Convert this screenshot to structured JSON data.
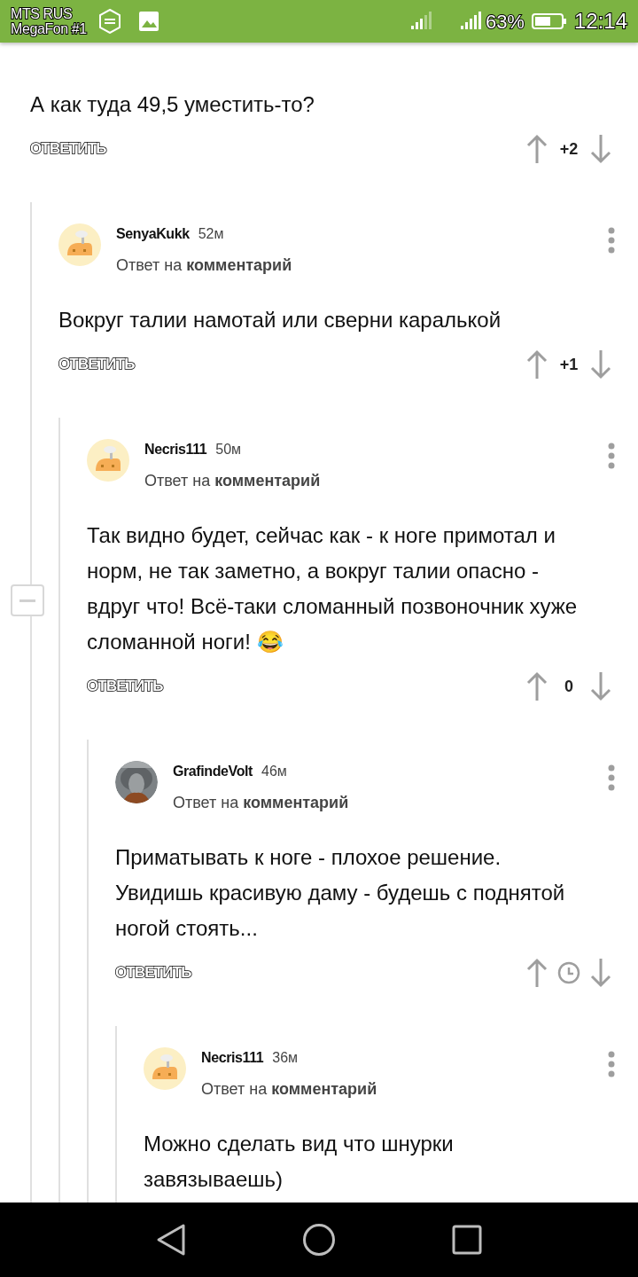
{
  "status_bar": {
    "carrier_lines": [
      "MTS RUS",
      "MegaFon #1"
    ],
    "battery": "63%",
    "time": "12:14"
  },
  "thread": {
    "text": "А как туда 49,5 уместить-то?",
    "reply_label": "ОТВЕТИТЬ",
    "rating": {
      "kind": "score",
      "text": "+2"
    },
    "children": [
      {
        "author": "SenyaKukk",
        "age": "52м",
        "avatar": {
          "kind": "default"
        },
        "reply_to": "Ответ на **комментарий**",
        "text": "Вокруг талии намотай или сверни каралькой",
        "reply_label": "ОТВЕТИТЬ",
        "rating": {
          "kind": "score",
          "text": "+1"
        },
        "children": [
          {
            "author": "Necris111",
            "age": "50м",
            "avatar": {
              "kind": "default"
            },
            "reply_to": "Ответ на **комментарий**",
            "text": "Так видно будет, сейчас как - к ноге примотал и норм, не так заметно, а вокруг талии опасно - вдруг что! Всё-таки сломанный позвоночник хуже сломанной ноги!",
            "emoji": "😂",
            "reply_label": "ОТВЕТИТЬ",
            "rating": {
              "kind": "score",
              "text": "0"
            },
            "children": [
              {
                "author": "GrafindeVolt",
                "age": "46м",
                "avatar": {
                  "kind": "picture"
                },
                "reply_to": "Ответ на **комментарий**",
                "text": "Приматывать к ноге - плохое решение. Увидишь красивую даму - будешь с поднятой ногой стоять...",
                "reply_label": "ОТВЕТИТЬ",
                "rating": {
                  "kind": "pending"
                },
                "children": [
                  {
                    "author": "Necris111",
                    "age": "36м",
                    "avatar": {
                      "kind": "default"
                    },
                    "reply_to": "Ответ на **комментарий**",
                    "text": "Можно сделать вид что шнурки завязываешь)"
                  }
                ]
              }
            ]
          }
        ]
      }
    ]
  }
}
